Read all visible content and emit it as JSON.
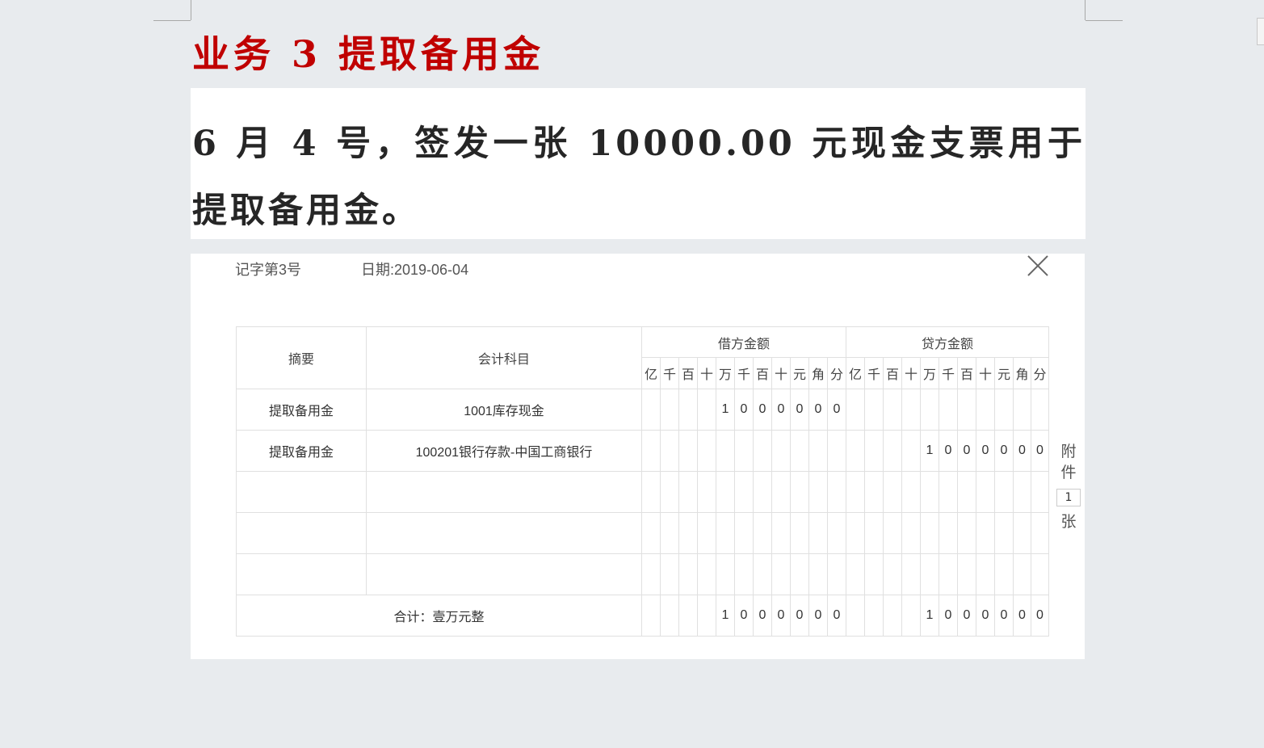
{
  "heading": "业务 3 提取备用金",
  "description": "6 月 4 号，签发一张 10000.00 元现金支票用于提取备用金。",
  "voucher": {
    "number": "记字第3号",
    "date": "日期:2019-06-04",
    "headers": {
      "summary": "摘要",
      "account": "会计科目",
      "debit": "借方金额",
      "credit": "贷方金额"
    },
    "units": [
      "亿",
      "千",
      "百",
      "十",
      "万",
      "千",
      "百",
      "十",
      "元",
      "角",
      "分"
    ],
    "rows": [
      {
        "summary": "提取备用金",
        "account": "1001库存现金",
        "debit": [
          "",
          "",
          "",
          "",
          "1",
          "0",
          "0",
          "0",
          "0",
          "0",
          "0"
        ],
        "credit": [
          "",
          "",
          "",
          "",
          "",
          "",
          "",
          "",
          "",
          "",
          ""
        ]
      },
      {
        "summary": "提取备用金",
        "account": "100201银行存款-中国工商银行",
        "debit": [
          "",
          "",
          "",
          "",
          "",
          "",
          "",
          "",
          "",
          "",
          ""
        ],
        "credit": [
          "",
          "",
          "",
          "",
          "1",
          "0",
          "0",
          "0",
          "0",
          "0",
          "0"
        ]
      },
      {
        "summary": "",
        "account": "",
        "debit": [
          "",
          "",
          "",
          "",
          "",
          "",
          "",
          "",
          "",
          "",
          ""
        ],
        "credit": [
          "",
          "",
          "",
          "",
          "",
          "",
          "",
          "",
          "",
          "",
          ""
        ]
      },
      {
        "summary": "",
        "account": "",
        "debit": [
          "",
          "",
          "",
          "",
          "",
          "",
          "",
          "",
          "",
          "",
          ""
        ],
        "credit": [
          "",
          "",
          "",
          "",
          "",
          "",
          "",
          "",
          "",
          "",
          ""
        ]
      },
      {
        "summary": "",
        "account": "",
        "debit": [
          "",
          "",
          "",
          "",
          "",
          "",
          "",
          "",
          "",
          "",
          ""
        ],
        "credit": [
          "",
          "",
          "",
          "",
          "",
          "",
          "",
          "",
          "",
          "",
          ""
        ]
      }
    ],
    "total": {
      "label": "合计：壹万元整",
      "debit": [
        "",
        "",
        "",
        "",
        "1",
        "0",
        "0",
        "0",
        "0",
        "0",
        "0"
      ],
      "credit": [
        "",
        "",
        "",
        "",
        "1",
        "0",
        "0",
        "0",
        "0",
        "0",
        "0"
      ]
    },
    "attachment": {
      "label_top": "附件",
      "count": "1",
      "label_bottom": "张"
    }
  }
}
